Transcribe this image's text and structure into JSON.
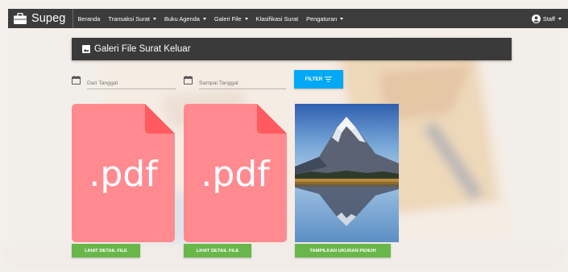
{
  "navbar": {
    "brand": "Supeg",
    "items": [
      {
        "label": "Beranda",
        "dropdown": false
      },
      {
        "label": "Transaksi Surat",
        "dropdown": true
      },
      {
        "label": "Buku Agenda",
        "dropdown": true
      },
      {
        "label": "Galeri File",
        "dropdown": true
      },
      {
        "label": "Klasifikasi Surat",
        "dropdown": false
      },
      {
        "label": "Pengaturan",
        "dropdown": true
      }
    ],
    "user": "Staff"
  },
  "header": {
    "title": "Galeri File Surat Keluar"
  },
  "filter": {
    "from_placeholder": "Dari Tanggal",
    "to_placeholder": "Sampai Tanggal",
    "button_label": "FILTER"
  },
  "gallery": {
    "items": [
      {
        "type": "pdf",
        "label": ".pdf",
        "button": "LIHAT DETAIL FILE"
      },
      {
        "type": "pdf",
        "label": ".pdf",
        "button": "LIHAT DETAIL FILE"
      },
      {
        "type": "image",
        "subject": "mountain-lake",
        "button": "TAMPILKAN UKURAN PENUH"
      }
    ]
  },
  "colors": {
    "navbar": "#3c3c3c",
    "header": "#3a3a3a",
    "filter_button": "#03a9f4",
    "pdf_tile": "#ff8a8f",
    "pdf_corner": "#ff5a60",
    "action_button": "#69b74a"
  },
  "icons": {
    "brand": "briefcase-icon",
    "user": "account-circle-icon",
    "header": "image-icon",
    "date": "calendar-icon",
    "filter": "filter-list-icon"
  }
}
